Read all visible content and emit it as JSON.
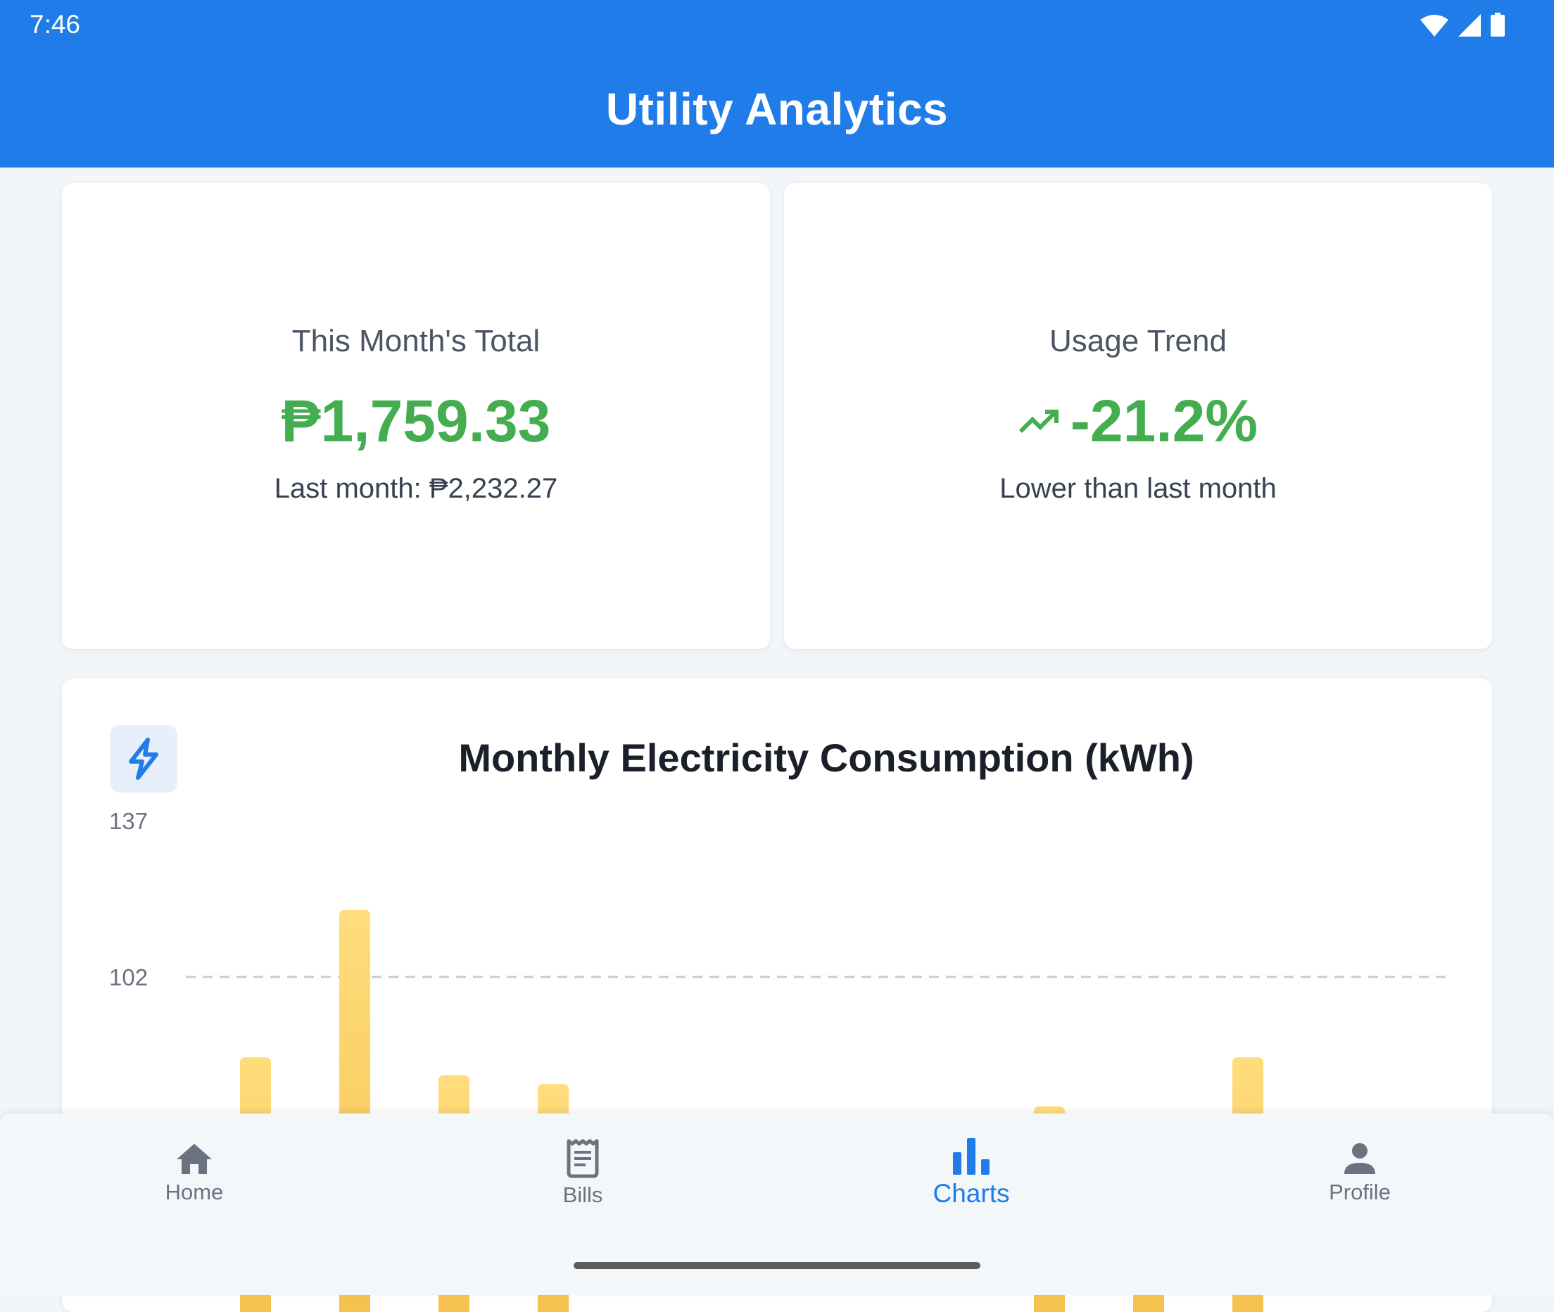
{
  "status_bar": {
    "time": "7:46",
    "icons": [
      "wifi-icon",
      "signal-icon",
      "battery-icon"
    ]
  },
  "app_bar": {
    "title": "Utility Analytics"
  },
  "summary": {
    "total": {
      "label": "This Month's Total",
      "value": "₱1,759.33",
      "sub": "Last month: ₱2,232.27"
    },
    "trend": {
      "label": "Usage Trend",
      "value": "-21.2%",
      "sub": "Lower than last month",
      "icon": "trending-up-icon"
    }
  },
  "chart": {
    "icon": "bolt-icon",
    "title": "Monthly Electricity Consumption (kWh)"
  },
  "chart_data": {
    "type": "bar",
    "title": "Monthly Electricity Consumption (kWh)",
    "y_ticks": [
      "137",
      "102"
    ],
    "reference_line": 102,
    "values": [
      84,
      117,
      80,
      78,
      0,
      0,
      0,
      0,
      73,
      67,
      84
    ],
    "colors": {
      "bar_top": "#ffdd7d",
      "bar_bottom": "#f5c04c",
      "grid": "#c8ccd2"
    }
  },
  "nav": {
    "items": [
      {
        "label": "Home",
        "icon": "home-icon"
      },
      {
        "label": "Bills",
        "icon": "receipt-icon"
      },
      {
        "label": "Charts",
        "icon": "bar-chart-icon"
      },
      {
        "label": "Profile",
        "icon": "person-icon"
      }
    ],
    "active_index": 2
  },
  "colors": {
    "primary": "#1f7ce8",
    "positive": "#43ad50"
  }
}
